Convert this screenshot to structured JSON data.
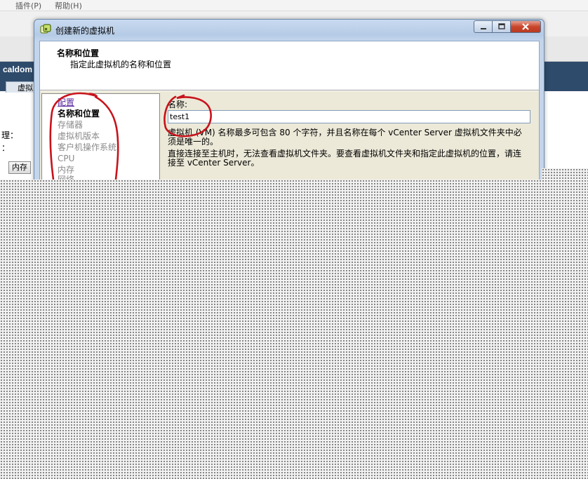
{
  "background": {
    "menubar_fragments": [
      "插件(P)",
      "帮助(H)"
    ],
    "host_label": "caldom",
    "tab_label": "虚拟",
    "label_a": "理：",
    "label_b": "：",
    "button_label": "内存"
  },
  "dialog": {
    "title": "创建新的虚拟机",
    "header": {
      "title": "名称和位置",
      "subtitle": "指定此虚拟机的名称和位置"
    },
    "nav": {
      "items": [
        {
          "label": "配置",
          "state": "link"
        },
        {
          "label": "名称和位置",
          "state": "active"
        },
        {
          "label": "存储器",
          "state": "pending"
        },
        {
          "label": "虚拟机版本",
          "state": "pending"
        },
        {
          "label": "客户机操作系统",
          "state": "pending"
        },
        {
          "label": "CPU",
          "state": "pending"
        },
        {
          "label": "内存",
          "state": "pending"
        },
        {
          "label": "网络",
          "state": "pending"
        }
      ]
    },
    "form": {
      "name_label": "名称:",
      "name_value": "test1",
      "info_1": "虚拟机 (VM) 名称最多可包含 80 个字符，并且名称在每个 vCenter Server 虚拟机文件夹中必须是唯一的。",
      "info_2": "直接连接至主机时，无法查看虚拟机文件夹。要查看虚拟机文件夹和指定此虚拟机的位置，请连接至 vCenter Server。"
    },
    "icons": {
      "app": "vsphere-icon",
      "minimize": "minimize-icon",
      "maximize": "maximize-icon",
      "close": "close-icon"
    }
  },
  "colors": {
    "annotation_red": "#c8121b",
    "titlebar": "#c3d5ec",
    "close_button": "#c9462c",
    "background_navy": "#2f4b6b"
  }
}
